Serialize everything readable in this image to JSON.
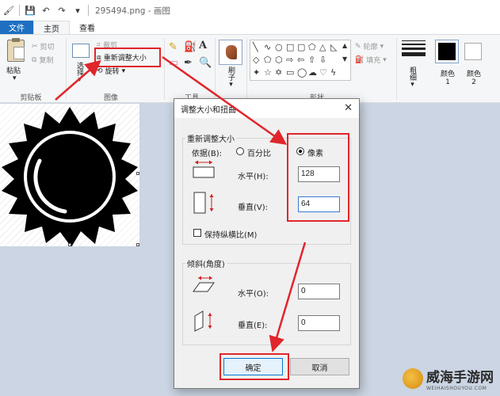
{
  "window": {
    "title": "295494.png - 画图"
  },
  "tabs": {
    "file": "文件",
    "home": "主页",
    "view": "查看"
  },
  "ribbon": {
    "clipboard": {
      "paste": "粘贴",
      "cut": "剪切",
      "copy": "复制",
      "group": "剪贴板"
    },
    "image": {
      "select": "选择",
      "crop": "裁剪",
      "resize": "重新调整大小",
      "rotate": "旋转",
      "group": "图像"
    },
    "tools_group": "工具",
    "brush": "刷子",
    "shapes": {
      "outline": "轮廓",
      "fill": "填充",
      "group": "形状"
    },
    "size": "粗细",
    "color1": "颜色 1",
    "color2": "颜色 2"
  },
  "dialog": {
    "title": "调整大小和扭曲",
    "resize_section": "重新调整大小",
    "by_label": "依据(B):",
    "percent": "百分比",
    "pixels": "像素",
    "horizontal_label": "水平(H):",
    "horizontal_value": "128",
    "vertical_label": "垂直(V):",
    "vertical_value": "64",
    "keep_ratio": "保持纵横比(M)",
    "skew_section": "倾斜(角度)",
    "skew_h_label": "水平(O):",
    "skew_h_value": "0",
    "skew_v_label": "垂直(E):",
    "skew_v_value": "0",
    "ok": "确定",
    "cancel": "取消"
  },
  "watermark": {
    "text": "威海手游网",
    "sub": "WEIHAISHOUYOU.COM"
  },
  "colors": {
    "accent": "#1e6fc1",
    "highlight": "#e0262b"
  }
}
